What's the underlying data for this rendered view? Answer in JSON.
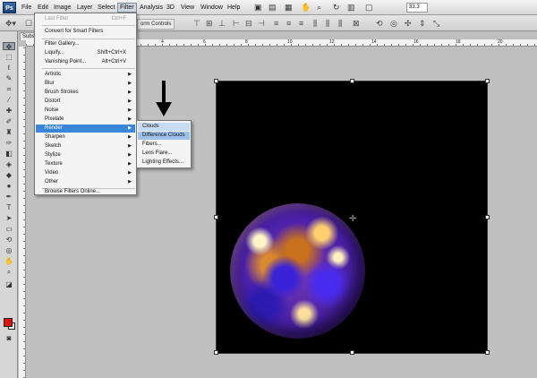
{
  "menubar": {
    "logo": "Ps",
    "items": [
      "File",
      "Edit",
      "Image",
      "Layer",
      "Select",
      "Filter",
      "Analysis",
      "3D",
      "View",
      "Window",
      "Help"
    ],
    "zoom": "33.3"
  },
  "optbar": {
    "form_controls": "orm Controls"
  },
  "document": {
    "tab": "Subse"
  },
  "ruler": {
    "numbers": [
      "4",
      "6",
      "8",
      "10",
      "12",
      "14",
      "16",
      "18",
      "20"
    ]
  },
  "filter_menu": {
    "last_filter": "Last Filter",
    "last_filter_shortcut": "Ctrl+F",
    "convert": "Convert for Smart Filters",
    "gallery": "Filter Gallery...",
    "liquify": "Liquify...",
    "liquify_shortcut": "Shift+Ctrl+X",
    "vanishing": "Vanishing Point...",
    "vanishing_shortcut": "Alt+Ctrl+V",
    "categories": [
      "Artistic",
      "Blur",
      "Brush Strokes",
      "Distort",
      "Noise",
      "Pixelate",
      "Render",
      "Sharpen",
      "Sketch",
      "Stylize",
      "Texture",
      "Video",
      "Other"
    ],
    "browse": "Browse Filters Online..."
  },
  "render_submenu": {
    "items": [
      "Clouds",
      "Difference Clouds",
      "Fibers...",
      "Lens Flare...",
      "Lighting Effects..."
    ]
  },
  "colors": {
    "foreground": "#e01010",
    "background": "#ffffff",
    "menu_highlight": "#3a86d8"
  }
}
